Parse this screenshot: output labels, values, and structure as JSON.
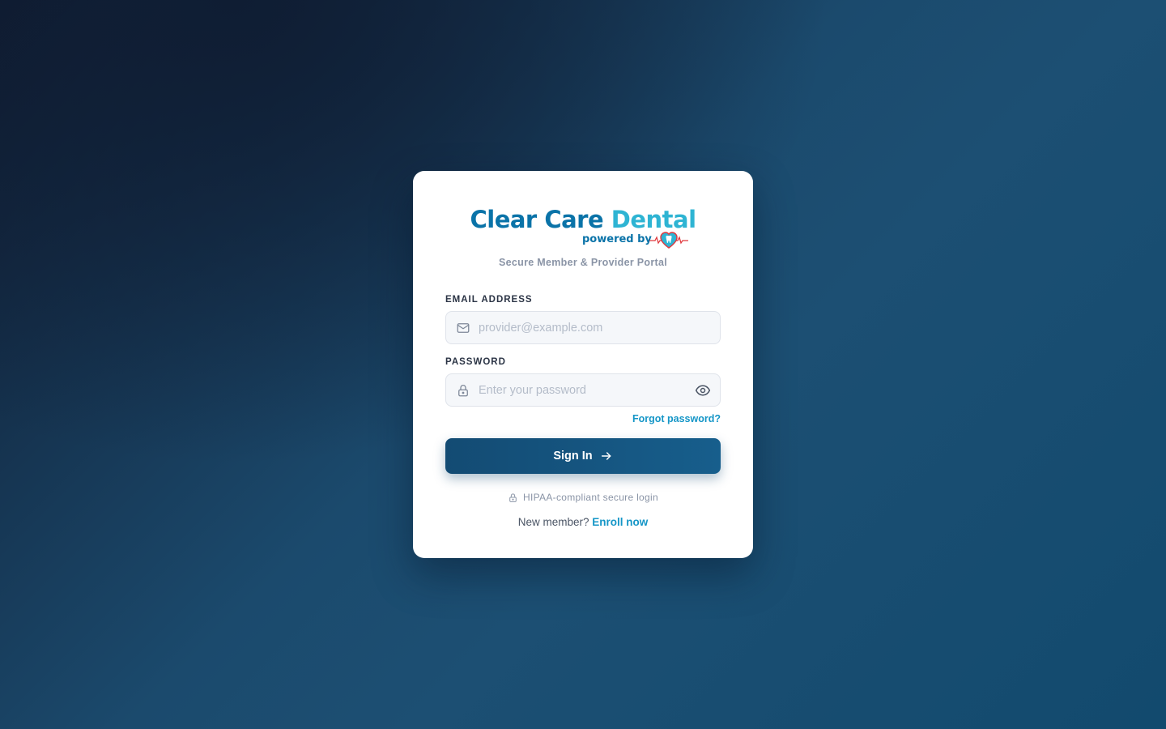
{
  "brand": {
    "wordmark_primary": "Clear Care",
    "wordmark_secondary": "Dental",
    "powered_by": "powered by",
    "heart_logo": "heart-tooth-heartbeat-icon",
    "colors": {
      "primary": "#0a73a8",
      "secondary": "#2eb4d3",
      "accent_red": "#e0393e"
    }
  },
  "portal": {
    "subtitle": "Secure Member & Provider Portal"
  },
  "form": {
    "email": {
      "label": "EMAIL ADDRESS",
      "placeholder": "provider@example.com",
      "value": "",
      "icon": "mail-icon"
    },
    "password": {
      "label": "PASSWORD",
      "placeholder": "Enter your password",
      "value": "",
      "icon": "lock-icon",
      "toggle_icon": "eye-icon"
    },
    "forgot_password": "Forgot password?",
    "submit": {
      "label": "Sign In",
      "icon": "arrow-right-icon",
      "color": "#134b73"
    }
  },
  "footer": {
    "security_note": "HIPAA-compliant secure login",
    "security_icon": "lock-icon",
    "new_member_text": "New member?",
    "enroll_link": "Enroll now",
    "link_color": "#1596c7"
  }
}
